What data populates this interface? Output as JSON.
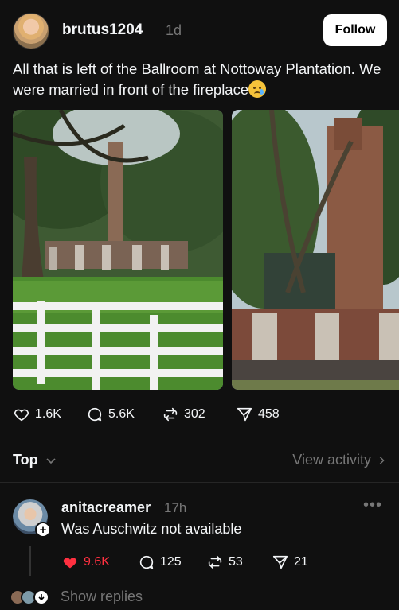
{
  "post": {
    "username": "brutus1204",
    "time": "1d",
    "follow_label": "Follow",
    "text": "All that is left of the Ballroom at Nottoway Plantation. We were married in front of the fireplace",
    "emoji": "crying-face"
  },
  "actions": {
    "likes": "1.6K",
    "comments": "5.6K",
    "reposts": "302",
    "shares": "458"
  },
  "sort": {
    "label": "Top",
    "view_activity": "View activity"
  },
  "reply": {
    "username": "anitacreamer",
    "time": "17h",
    "text": "Was Auschwitz not available",
    "likes": "9.6K",
    "comments": "125",
    "reposts": "53",
    "shares": "21",
    "liked": true
  },
  "show_replies": "Show replies",
  "colors": {
    "background": "#101010",
    "text": "#f3f5f7",
    "muted": "#777777",
    "like_red": "#ff3040"
  }
}
